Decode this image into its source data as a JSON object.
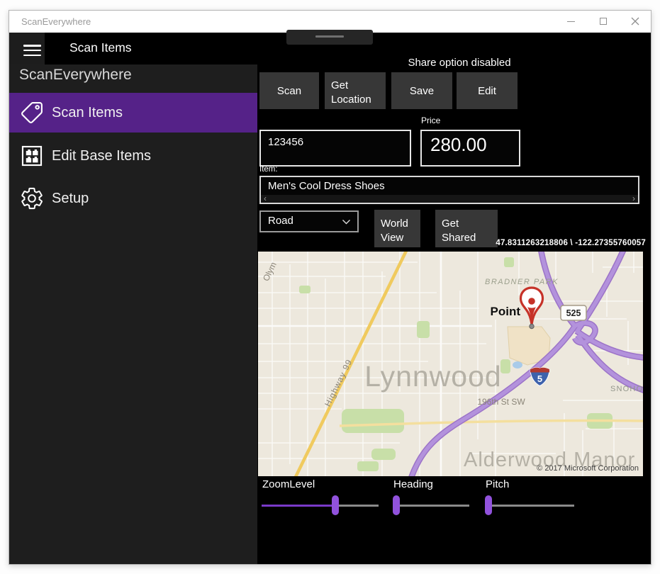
{
  "window": {
    "title": "ScanEverywhere"
  },
  "header": {
    "page_title": "Scan Items"
  },
  "sidebar": {
    "app_title": "ScanEverywhere",
    "items": [
      {
        "label": "Scan Items",
        "icon": "tag-icon",
        "selected": true
      },
      {
        "label": "Edit Base Items",
        "icon": "grid-icon",
        "selected": false
      },
      {
        "label": "Setup",
        "icon": "gear-icon",
        "selected": false
      }
    ]
  },
  "toolbar": {
    "status": "Share option disabled",
    "scan": "Scan",
    "get_location": "Get Location",
    "save": "Save",
    "edit": "Edit"
  },
  "form": {
    "barcode_value": "123456",
    "price_label": "Price",
    "price_value": "280.00",
    "item_label": "Item:",
    "item_value": "Men's Cool Dress Shoes",
    "map_style_selected": "Road",
    "world_view_label": "World View",
    "get_shared_label": "Get Shared",
    "coordinates": "47.8311263218806 \\ -122.27355760057"
  },
  "icons": {
    "scroll_left": "‹",
    "scroll_right": "›"
  },
  "map": {
    "city_label": "Lynnwood",
    "district_label": "Alderwood Manor",
    "park_label": "BRADNER PARK",
    "county_label": "SNOHOMISH",
    "street_label": "196th St SW",
    "highway_label": "Highway 99",
    "partial_label": "Olym",
    "pin_label": "Point",
    "route_badge": "525",
    "interstate_badge": "5",
    "copyright": "© 2017 Microsoft Corporation"
  },
  "sliders": [
    {
      "label": "ZoomLevel",
      "value_pct": 64
    },
    {
      "label": "Heading",
      "value_pct": 0
    },
    {
      "label": "Pitch",
      "value_pct": 0
    }
  ],
  "colors": {
    "accent": "#552288",
    "sliderFill": "#7A3AC8",
    "sliderThumb": "#9152DC",
    "buttonBg": "#373737",
    "paneBg": "#1E1E1E"
  }
}
